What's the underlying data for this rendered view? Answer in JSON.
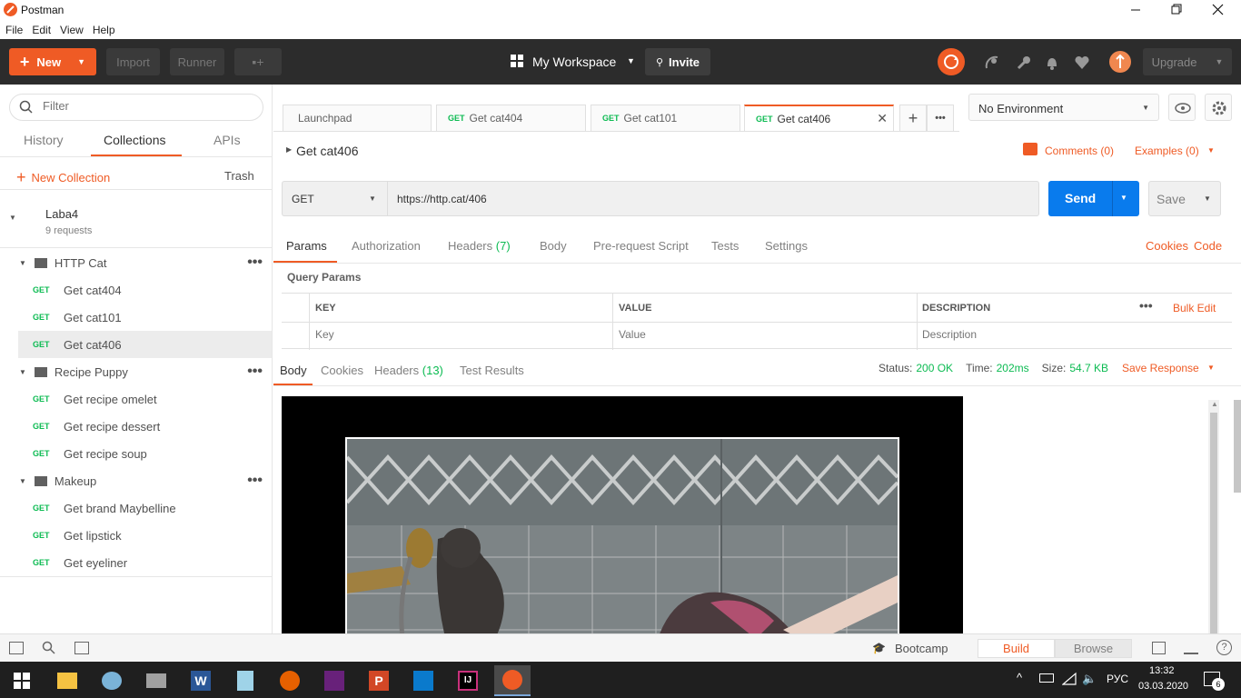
{
  "window": {
    "title": "Postman",
    "menu": [
      "File",
      "Edit",
      "View",
      "Help"
    ]
  },
  "header": {
    "new_label": "New",
    "import_label": "Import",
    "runner_label": "Runner",
    "workspace_label": "My Workspace",
    "invite_label": "Invite",
    "upgrade_label": "Upgrade",
    "accent_color": "#ef5b25"
  },
  "sidebar": {
    "filter_placeholder": "Filter",
    "tabs": [
      "History",
      "Collections",
      "APIs"
    ],
    "new_collection_label": "New Collection",
    "trash_label": "Trash",
    "collection": {
      "name": "Laba4",
      "count": "9 requests"
    },
    "folders": [
      {
        "name": "HTTP Cat",
        "requests": [
          {
            "method": "GET",
            "name": "Get cat404"
          },
          {
            "method": "GET",
            "name": "Get cat101"
          },
          {
            "method": "GET",
            "name": "Get cat406"
          }
        ]
      },
      {
        "name": "Recipe Puppy",
        "requests": [
          {
            "method": "GET",
            "name": "Get recipe omelet"
          },
          {
            "method": "GET",
            "name": "Get recipe dessert"
          },
          {
            "method": "GET",
            "name": "Get recipe soup"
          }
        ]
      },
      {
        "name": "Makeup",
        "requests": [
          {
            "method": "GET",
            "name": "Get brand Maybelline"
          },
          {
            "method": "GET",
            "name": "Get lipstick"
          },
          {
            "method": "GET",
            "name": "Get eyeliner"
          }
        ]
      }
    ]
  },
  "tabs": {
    "launchpad": "Launchpad",
    "items": [
      {
        "method": "GET",
        "name": "Get cat404"
      },
      {
        "method": "GET",
        "name": "Get cat101"
      },
      {
        "method": "GET",
        "name": "Get cat406"
      }
    ]
  },
  "environment": {
    "selected": "No Environment"
  },
  "request": {
    "title": "Get cat406",
    "comments_label": "Comments (0)",
    "examples_label": "Examples (0)",
    "method": "GET",
    "url": "https://http.cat/406",
    "send_label": "Send",
    "save_label": "Save",
    "tabs": [
      "Params",
      "Authorization",
      "Headers",
      "Body",
      "Pre-request Script",
      "Tests",
      "Settings"
    ],
    "headers_count": "(7)",
    "cookies_label": "Cookies",
    "code_label": "Code",
    "query_params_label": "Query Params",
    "table": {
      "headers": [
        "KEY",
        "VALUE",
        "DESCRIPTION"
      ],
      "bulk_edit": "Bulk Edit",
      "placeholders": [
        "Key",
        "Value",
        "Description"
      ]
    }
  },
  "response": {
    "tabs": [
      "Body",
      "Cookies",
      "Headers",
      "Test Results"
    ],
    "headers_count": "(13)",
    "status_label": "Status:",
    "status_value": "200 OK",
    "time_label": "Time:",
    "time_value": "202ms",
    "size_label": "Size:",
    "size_value": "54.7 KB",
    "save_response_label": "Save Response"
  },
  "statusbar": {
    "bootcamp_label": "Bootcamp",
    "build_label": "Build",
    "browse_label": "Browse"
  },
  "taskbar": {
    "lang": "РУС",
    "time": "13:32",
    "date": "03.03.2020",
    "notifications": "6"
  }
}
